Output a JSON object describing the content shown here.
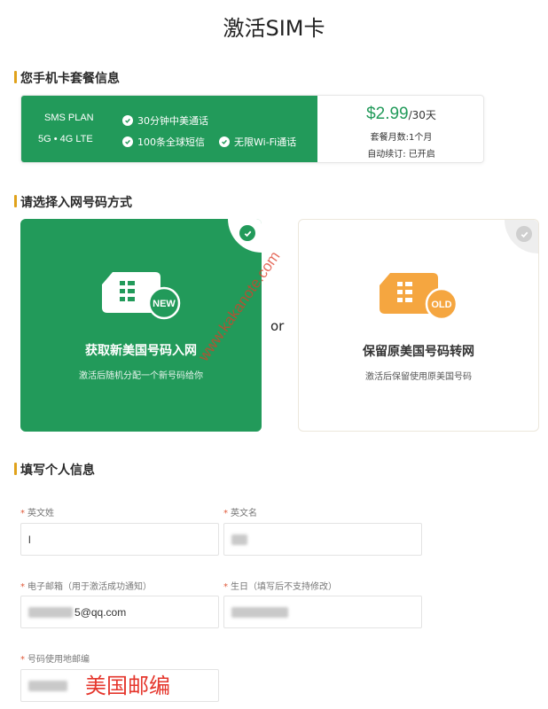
{
  "page": {
    "title": "激活SIM卡"
  },
  "plan_section": {
    "title": "您手机卡套餐信息",
    "plan_name": "SMS PLAN",
    "network": "5G • 4G LTE",
    "features": [
      "30分钟中美通话",
      "100条全球短信",
      "无限Wi-Fi通话"
    ],
    "price": "$2.99",
    "price_unit": "/30天",
    "months": "套餐月数:1个月",
    "auto_renew": "自动续订: 已开启"
  },
  "number_section": {
    "title": "请选择入网号码方式",
    "options": [
      {
        "label": "获取新美国号码入网",
        "desc": "激活后随机分配一个新号码给你",
        "badge": "NEW",
        "selected": true
      },
      {
        "label": "保留原美国号码转网",
        "desc": "激活后保留使用原美国号码",
        "badge": "OLD",
        "selected": false
      }
    ],
    "or_text": "or"
  },
  "personal_section": {
    "title": "填写个人信息",
    "fields": {
      "last_name": {
        "label": "英文姓",
        "value": "l"
      },
      "first_name": {
        "label": "英文名",
        "value": ""
      },
      "email": {
        "label": "电子邮箱（用于激活成功通知）",
        "value": "5@qq.com"
      },
      "birthday": {
        "label": "生日（填写后不支持修改）",
        "value": ""
      },
      "zip": {
        "label": "号码使用地邮编",
        "value": ""
      }
    },
    "required_mark": "*"
  },
  "annotation": "美国邮编",
  "watermark": "www.kakanote.com",
  "colors": {
    "brand_green": "#229a5a",
    "accent_orange": "#f5a640",
    "section_bar": "#e0a21b"
  }
}
